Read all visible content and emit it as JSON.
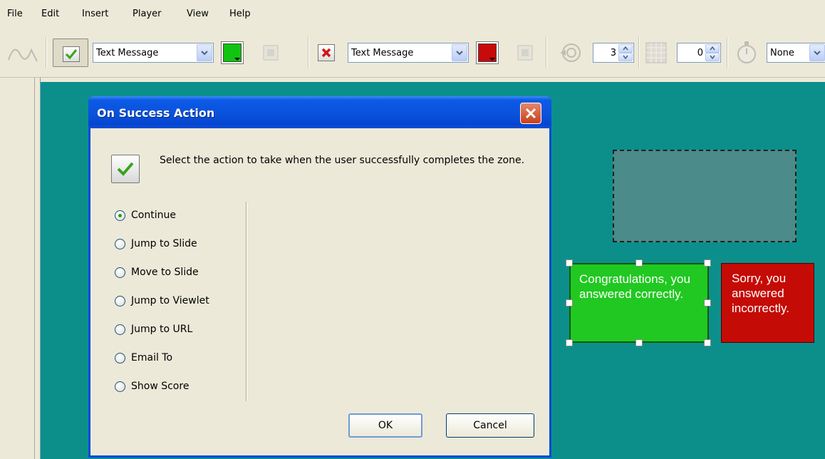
{
  "menu": [
    "File",
    "Edit",
    "Insert",
    "Player",
    "View",
    "Help"
  ],
  "toolbar": {
    "success_action_label": "Text Message",
    "failure_action_label": "Text Message",
    "success_color": "#11c411",
    "failure_color": "#c80a0a",
    "attempts_value": "3",
    "delay_value": "0",
    "timer_label": "None"
  },
  "canvas": {
    "success_caption": "Congratulations, you answered correctly.",
    "failure_caption": "Sorry, you answered incorrectly."
  },
  "dialog": {
    "title": "On Success Action",
    "description": "Select the action to take when the user successfully completes the zone.",
    "options": [
      "Continue",
      "Jump to Slide",
      "Move to Slide",
      "Jump to Viewlet",
      "Jump to URL",
      "Email To",
      "Show Score"
    ],
    "selected_option": "Continue",
    "ok_label": "OK",
    "cancel_label": "Cancel"
  },
  "colors": {
    "canvas_bg": "#0c8f8b",
    "titlebar": "#0a52dc"
  }
}
